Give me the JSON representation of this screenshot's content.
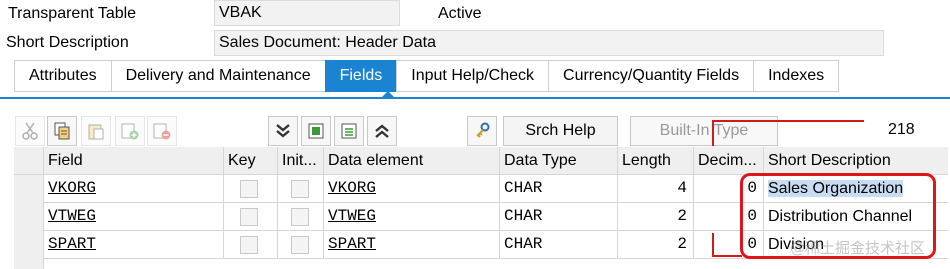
{
  "header": {
    "transparent_table_label": "Transparent Table",
    "table_name": "VBAK",
    "status": "Active",
    "short_description_label": "Short Description",
    "short_description_value": "Sales Document: Header Data"
  },
  "tabs": [
    {
      "label": "Attributes",
      "active": false
    },
    {
      "label": "Delivery and Maintenance",
      "active": false
    },
    {
      "label": "Fields",
      "active": true
    },
    {
      "label": "Input Help/Check",
      "active": false
    },
    {
      "label": "Currency/Quantity Fields",
      "active": false
    },
    {
      "label": "Indexes",
      "active": false
    }
  ],
  "toolbar": {
    "icons": [
      "cut-icon",
      "copy-icon",
      "paste-icon",
      "insert-row-icon",
      "delete-row-icon",
      "collapse-all-icon",
      "expand-icon",
      "new-entry-icon",
      "expand-all-icon",
      "key-icon"
    ],
    "srch_help_label": "Srch Help",
    "builtin_type_label": "Built-In Type",
    "field_count": "218"
  },
  "grid": {
    "columns": [
      "Field",
      "Key",
      "Init...",
      "Data element",
      "Data Type",
      "Length",
      "Decim...",
      "Short Description"
    ],
    "rows": [
      {
        "field": "VKORG",
        "data_element": "VKORG",
        "data_type": "CHAR",
        "length": "4",
        "decimals": "0",
        "short_description": "Sales Organization"
      },
      {
        "field": "VTWEG",
        "data_element": "VTWEG",
        "data_type": "CHAR",
        "length": "2",
        "decimals": "0",
        "short_description": "Distribution Channel"
      },
      {
        "field": "SPART",
        "data_element": "SPART",
        "data_type": "CHAR",
        "length": "2",
        "decimals": "0",
        "short_description": "Division"
      }
    ]
  },
  "watermark": "@稀土掘金技术社区",
  "colors": {
    "accent": "#1b84d2",
    "annotation": "#e0141b"
  }
}
